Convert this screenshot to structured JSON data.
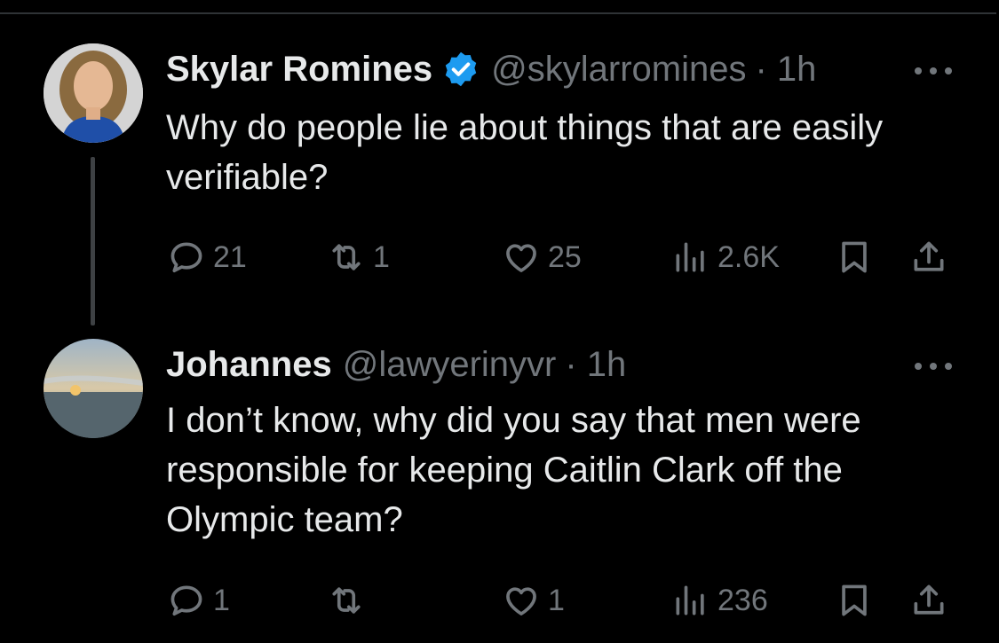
{
  "tweets": [
    {
      "display_name": "Skylar Romines",
      "handle": "@skylarromines",
      "time": "· 1h",
      "verified": true,
      "text": "Why do people lie about things that are easily verifiable?",
      "actions": {
        "replies": "21",
        "reposts": "1",
        "likes": "25",
        "views": "2.6K"
      }
    },
    {
      "display_name": "Johannes",
      "handle": "@lawyerinyvr",
      "time": "· 1h",
      "verified": false,
      "text": "I don’t know, why did you say that men were responsible for keeping Caitlin Clark off the Olympic team?",
      "actions": {
        "replies": "1",
        "reposts": "",
        "likes": "1",
        "views": "236"
      }
    }
  ],
  "icons": {
    "reply": "reply-icon",
    "repost": "repost-icon",
    "like": "like-icon",
    "views": "views-icon",
    "bookmark": "bookmark-icon",
    "share": "share-icon",
    "more": "more-icon",
    "verified": "verified-badge-icon"
  },
  "colors": {
    "background": "#000000",
    "text": "#e7e9ea",
    "secondary": "#71767b",
    "verified": "#1d9bf0"
  }
}
